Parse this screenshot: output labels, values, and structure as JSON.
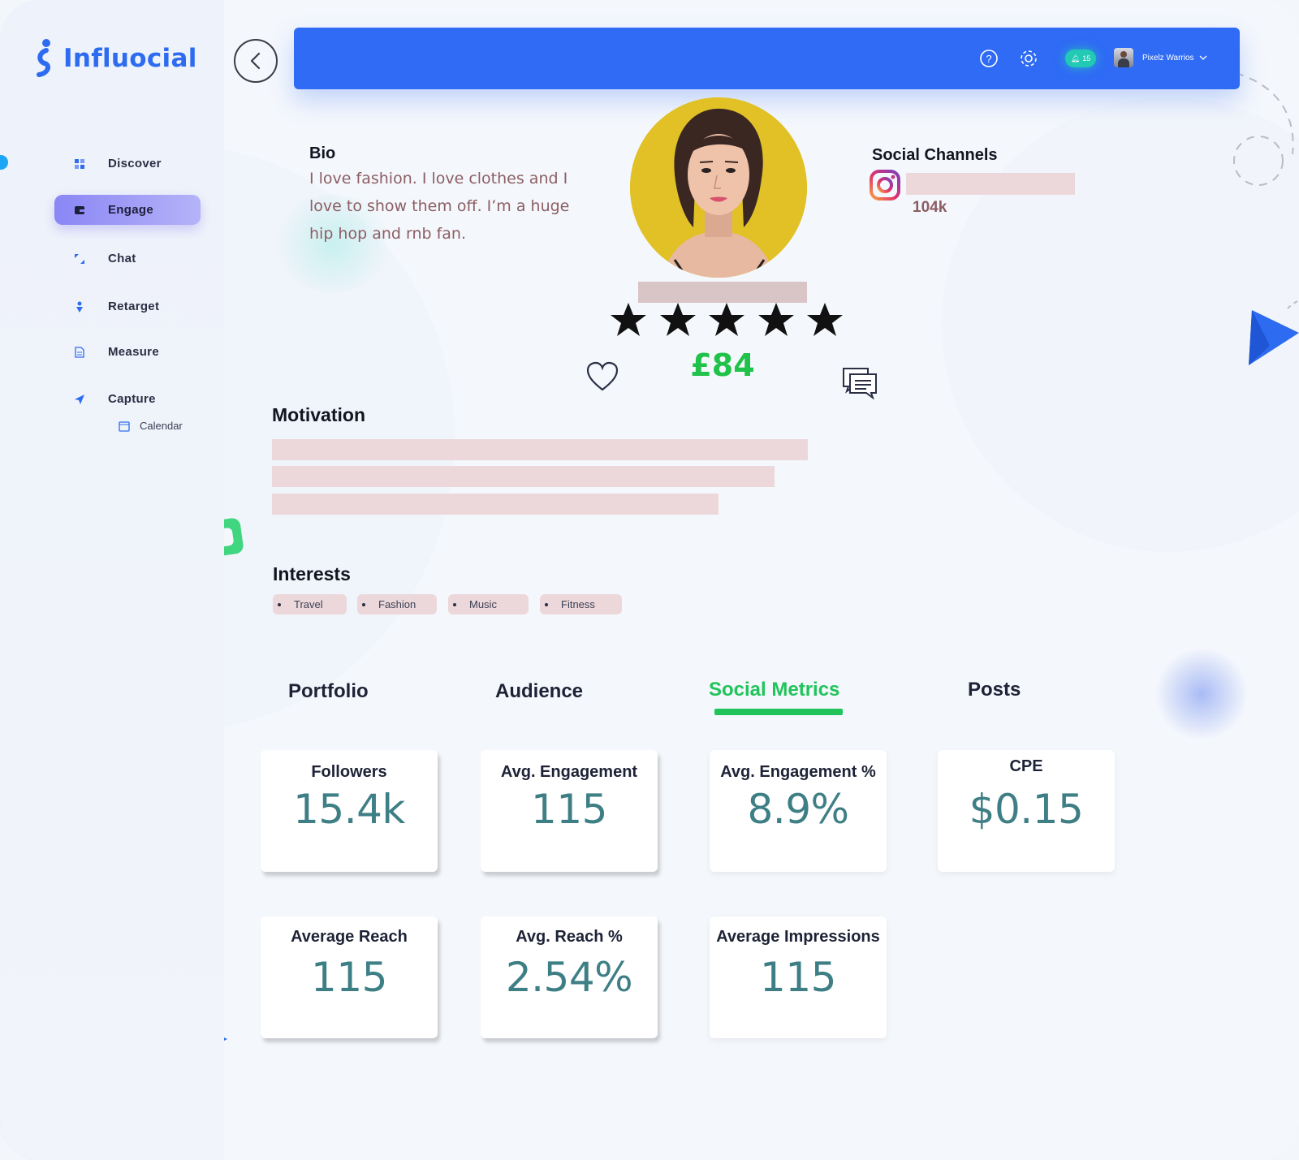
{
  "app": {
    "name": "Influocial"
  },
  "sidebar": {
    "items": [
      {
        "label": "Discover",
        "icon": "grid-icon"
      },
      {
        "label": "Engage",
        "icon": "wallet-icon",
        "active": true
      },
      {
        "label": "Chat",
        "icon": "arrows-icon"
      },
      {
        "label": "Retarget",
        "icon": "pin-icon"
      },
      {
        "label": "Measure",
        "icon": "document-icon"
      },
      {
        "label": "Capture",
        "icon": "send-icon"
      }
    ],
    "sub_item": {
      "label": "Calendar",
      "icon": "calendar-icon"
    }
  },
  "header": {
    "notification_count": "15",
    "user_name": "Pixelz Warrios"
  },
  "profile": {
    "bio_title": "Bio",
    "bio_text": "I love fashion. I love clothes and I love to show them off. I’m a huge hip hop and rnb fan.",
    "rating": 5,
    "price": "£84",
    "social_title": "Social Channels",
    "social_channels": [
      {
        "network": "instagram",
        "icon": "instagram-icon",
        "count": "104k"
      }
    ],
    "motivation_title": "Motivation",
    "interests_title": "Interests",
    "interests": [
      "Travel",
      "Fashion",
      "Music",
      "Fitness"
    ]
  },
  "tabs": [
    {
      "label": "Portfolio"
    },
    {
      "label": "Audience"
    },
    {
      "label": "Social Metrics",
      "active": true
    },
    {
      "label": "Posts"
    }
  ],
  "metrics": [
    {
      "label": "Followers",
      "value": "15.4k"
    },
    {
      "label": "Avg. Engagement",
      "value": "115"
    },
    {
      "label": "Avg. Engagement %",
      "value": "8.9%"
    },
    {
      "label": "CPE",
      "value": "$0.15"
    },
    {
      "label": "Average Reach",
      "value": "115"
    },
    {
      "label": "Avg. Reach %",
      "value": "2.54%"
    },
    {
      "label": "Average Impressions",
      "value": "115"
    }
  ],
  "colors": {
    "brand_blue": "#2f6bf5",
    "accent_green": "#20c45a",
    "engage_purple": "#8a86f5",
    "metric_teal": "#3e7f86"
  }
}
